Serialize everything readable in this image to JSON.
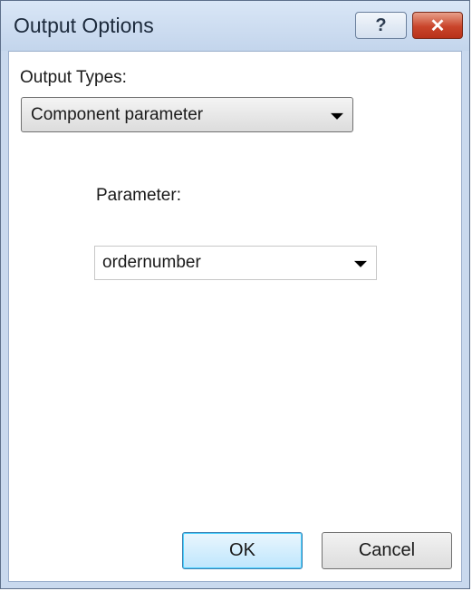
{
  "window": {
    "title": "Output Options",
    "help_glyph": "?",
    "close_glyph": "✕"
  },
  "output_types": {
    "label": "Output Types:",
    "selected": "Component parameter"
  },
  "parameter": {
    "label": "Parameter:",
    "selected": "ordernumber"
  },
  "buttons": {
    "ok": "OK",
    "cancel": "Cancel"
  },
  "icons": {
    "help": "question-mark-icon",
    "close": "close-icon",
    "dropdown": "chevron-down-icon"
  }
}
